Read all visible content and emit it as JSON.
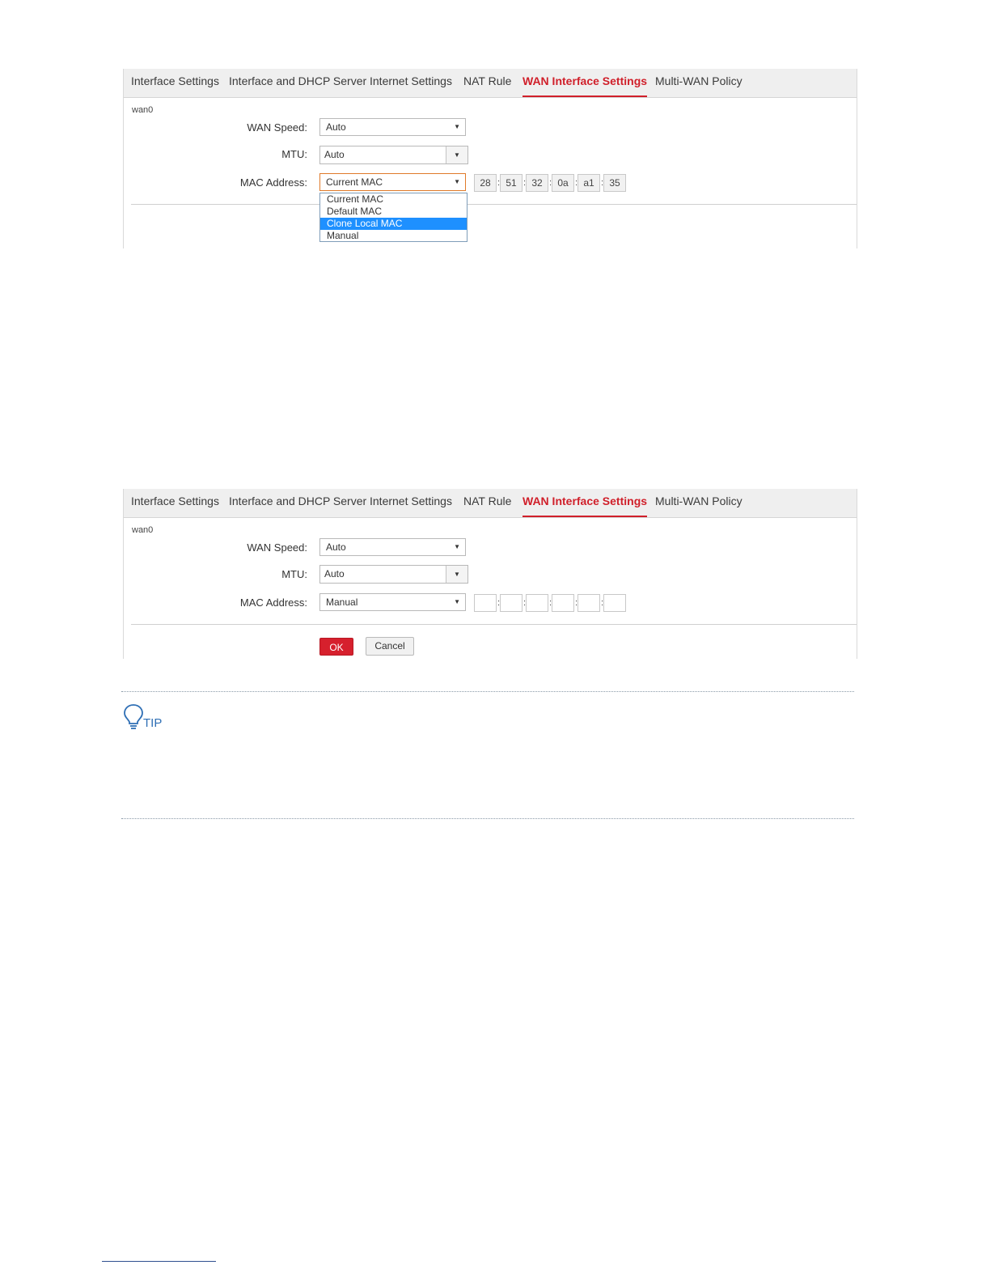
{
  "tabs": [
    "Interface Settings",
    "Interface and DHCP Server",
    "Internet Settings",
    "NAT Rule",
    "WAN Interface Settings",
    "Multi-WAN Policy"
  ],
  "active_tab": "WAN Interface Settings",
  "screen1": {
    "interface_name": "wan0",
    "wan_speed_label": "WAN Speed:",
    "wan_speed_value": "Auto",
    "mtu_label": "MTU:",
    "mtu_value": "Auto",
    "mac_label": "MAC Address:",
    "mac_mode_value": "Current MAC",
    "mac_octets": [
      "28",
      "51",
      "32",
      "0a",
      "a1",
      "35"
    ],
    "mac_separator": ":",
    "mac_options": [
      "Current MAC",
      "Default MAC",
      "Clone Local MAC",
      "Manual"
    ],
    "highlighted_option": "Clone Local MAC"
  },
  "screen2": {
    "interface_name": "wan0",
    "wan_speed_label": "WAN Speed:",
    "wan_speed_value": "Auto",
    "mtu_label": "MTU:",
    "mtu_value": "Auto",
    "mac_label": "MAC Address:",
    "mac_mode_value": "Manual",
    "mac_octets": [
      "",
      "",
      "",
      "",
      "",
      ""
    ],
    "mac_separator": ":",
    "ok_label": "OK",
    "cancel_label": "Cancel"
  },
  "tip": {
    "label": "TIP",
    "icon": "lightbulb-icon"
  },
  "colors": {
    "accent_red": "#d01f2a",
    "highlight_blue": "#1e90ff",
    "tip_blue": "#2f6fb5"
  }
}
